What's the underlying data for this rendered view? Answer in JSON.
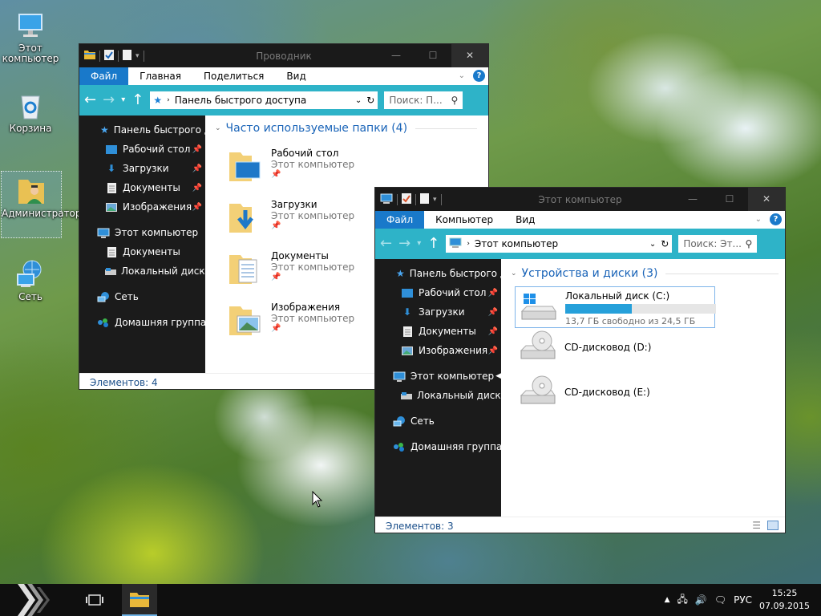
{
  "desktop": {
    "icons": [
      {
        "label": "Этот компьютер"
      },
      {
        "label": "Корзина"
      },
      {
        "label": "Администратор"
      },
      {
        "label": "Сеть"
      }
    ]
  },
  "window1": {
    "title": "Проводник",
    "ribbon_tabs": [
      "Файл",
      "Главная",
      "Поделиться",
      "Вид"
    ],
    "address": "Панель быстрого доступа",
    "search_placeholder": "Поиск: П...",
    "sidebar": [
      {
        "label": "Панель быстрого доступа"
      },
      {
        "label": "Рабочий стол"
      },
      {
        "label": "Загрузки"
      },
      {
        "label": "Документы"
      },
      {
        "label": "Изображения"
      },
      {
        "label": "Этот компьютер"
      },
      {
        "label": "Документы"
      },
      {
        "label": "Локальный диск (C:)"
      },
      {
        "label": "Сеть"
      },
      {
        "label": "Домашняя группа"
      }
    ],
    "section_title": "Часто используемые папки (4)",
    "folders": [
      {
        "name": "Рабочий стол",
        "location": "Этот компьютер"
      },
      {
        "name": "Загрузки",
        "location": "Этот компьютер"
      },
      {
        "name": "Документы",
        "location": "Этот компьютер"
      },
      {
        "name": "Изображения",
        "location": "Этот компьютер"
      }
    ],
    "status": "Элементов: 4"
  },
  "window2": {
    "title": "Этот компьютер",
    "ribbon_tabs": [
      "Файл",
      "Компьютер",
      "Вид"
    ],
    "address": "Этот компьютер",
    "search_placeholder": "Поиск: Эт...",
    "sidebar": [
      {
        "label": "Панель быстрого доступа"
      },
      {
        "label": "Рабочий стол"
      },
      {
        "label": "Загрузки"
      },
      {
        "label": "Документы"
      },
      {
        "label": "Изображения"
      },
      {
        "label": "Этот компьютер"
      },
      {
        "label": "Локальный диск (C:)"
      },
      {
        "label": "Сеть"
      },
      {
        "label": "Домашняя группа"
      }
    ],
    "section_title": "Устройства и диски (3)",
    "drives": [
      {
        "name": "Локальный диск (C:)",
        "free": "13,7 ГБ свободно из 24,5 ГБ",
        "used_fraction": 0.44
      },
      {
        "name": "CD-дисковод (D:)"
      },
      {
        "name": "CD-дисковод (E:)"
      }
    ],
    "status": "Элементов: 3"
  },
  "taskbar": {
    "language": "РУС",
    "time": "15:25",
    "date": "07.09.2015"
  },
  "colors": {
    "accent": "#1979ca",
    "address_bar": "#2eb3c8",
    "sidebar_bg": "#1b1b1b",
    "titlebar_bg": "#1a1a1a"
  }
}
